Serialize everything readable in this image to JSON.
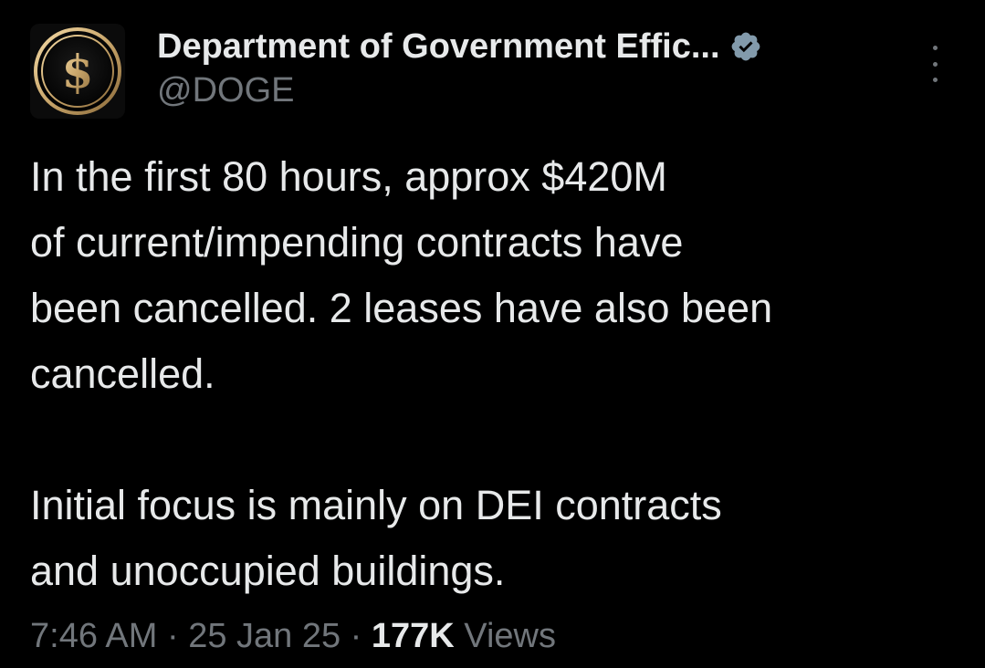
{
  "author": {
    "display_name": "Department of Government Effic...",
    "handle": "@DOGE",
    "avatar_icon": "dollar-coin-icon",
    "verified_icon": "verified-badge-icon",
    "accent_color": "#c9a66b"
  },
  "menu": {
    "icon": "more-vertical-icon"
  },
  "tweet": {
    "paragraph1": [
      "In the first 80 hours, approx $420M",
      "of current/impending contracts have",
      "been cancelled. 2 leases have also been",
      "cancelled."
    ],
    "paragraph2": [
      "Initial focus is mainly on DEI contracts",
      "and unoccupied buildings."
    ]
  },
  "meta": {
    "time": "7:46 AM",
    "separator": " · ",
    "date": "25 Jan 25",
    "views_count": "177K",
    "views_label": " Views"
  }
}
